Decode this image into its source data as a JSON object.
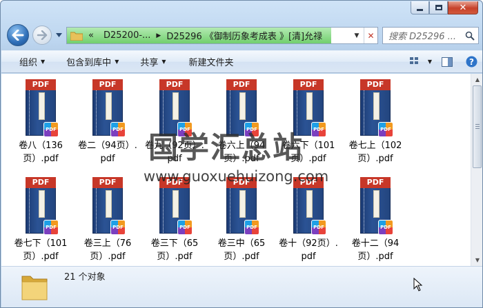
{
  "address": {
    "overflow": "«",
    "crumbs": [
      "D25200-...",
      "D25296 《御制历象考成表 》[清]允禄"
    ]
  },
  "search": {
    "placeholder": "搜索 D25296 ..."
  },
  "toolbar": {
    "organize": "组织",
    "include_library": "包含到库中",
    "share": "共享",
    "new_folder": "新建文件夹"
  },
  "files": [
    {
      "name": "卷八（136页）.pdf"
    },
    {
      "name": "卷二（94页）.pdf"
    },
    {
      "name": "卷九（92页）.pdf"
    },
    {
      "name": "卷六上（94页）.pdf"
    },
    {
      "name": "卷六下（101页）.pdf"
    },
    {
      "name": "卷七上（102页）.pdf"
    },
    {
      "name": "卷七下（101页）.pdf"
    },
    {
      "name": "卷三上（76页）.pdf"
    },
    {
      "name": "卷三下（65页）.pdf"
    },
    {
      "name": "卷三中（65页）.pdf"
    },
    {
      "name": "卷十（92页）.pdf"
    },
    {
      "name": "卷十二（94页）.pdf"
    }
  ],
  "file_badge": "PDF",
  "watermark": {
    "title": "国学汇总站",
    "url": "www.guoxuehuizong.com"
  },
  "status": {
    "count": "21 个对象"
  }
}
